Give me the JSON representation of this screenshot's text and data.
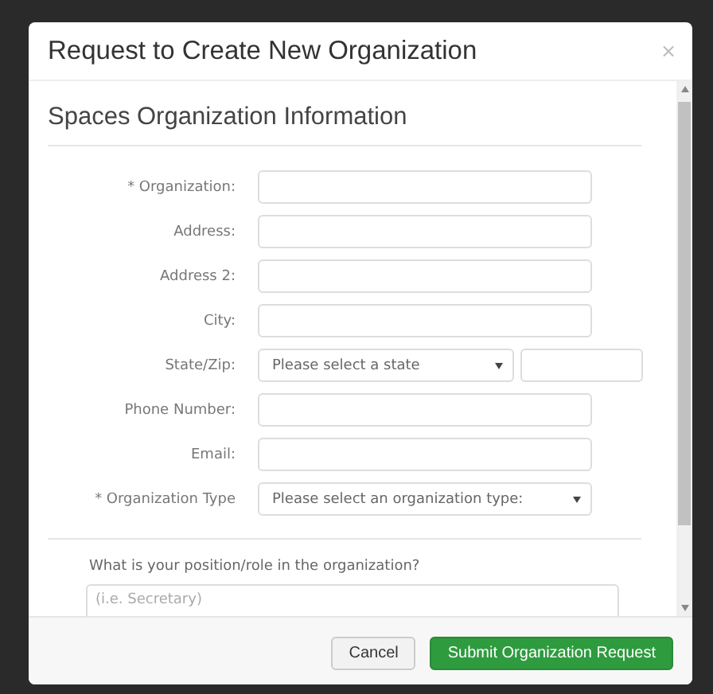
{
  "dialog": {
    "title": "Request to Create New Organization",
    "close": "×"
  },
  "section": {
    "heading": "Spaces Organization Information"
  },
  "fields": [
    {
      "label": "* Organization:",
      "kind": "text"
    },
    {
      "label": "Address:",
      "kind": "text"
    },
    {
      "label": "Address 2:",
      "kind": "text"
    },
    {
      "label": "City:",
      "kind": "text"
    },
    {
      "label": "State/Zip:",
      "kind": "select-zip",
      "placeholder": "Please select a state"
    },
    {
      "label": "Phone Number:",
      "kind": "text"
    },
    {
      "label": "Email:",
      "kind": "text"
    },
    {
      "label": "* Organization Type",
      "kind": "select",
      "placeholder": "Please select an organization type:"
    }
  ],
  "question": {
    "label": "What is your position/role in the organization?",
    "placeholder": "(i.e. Secretary)"
  },
  "buttons": [
    {
      "label": "Cancel",
      "kind": "default"
    },
    {
      "label": "Submit Organization Request",
      "kind": "primary"
    }
  ]
}
